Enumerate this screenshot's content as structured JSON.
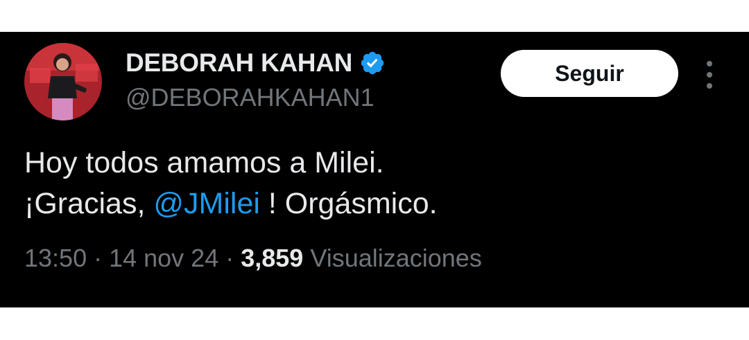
{
  "tweet": {
    "display_name": "DEBORAH KAHAN",
    "handle": "@DEBORAHKAHAN1",
    "follow_label": "Seguir",
    "text_line1": "Hoy todos amamos a Milei.",
    "text_line2_prefix": "¡Gracias, ",
    "mention": "@JMilei",
    "text_line2_suffix": " ! Orgásmico.",
    "time": "13:50",
    "date": "14 nov 24",
    "separator": " · ",
    "views_count": "3,859",
    "views_label": "Visualizaciones"
  },
  "icons": {
    "verified": "verified-badge-icon",
    "more": "more-vertical-icon",
    "avatar": "profile-photo"
  },
  "colors": {
    "background": "#000000",
    "primary_text": "#e7e9ea",
    "secondary_text": "#71767b",
    "mention": "#1d9bf0",
    "verified": "#1d9bf0",
    "follow_button_bg": "#ffffff"
  }
}
